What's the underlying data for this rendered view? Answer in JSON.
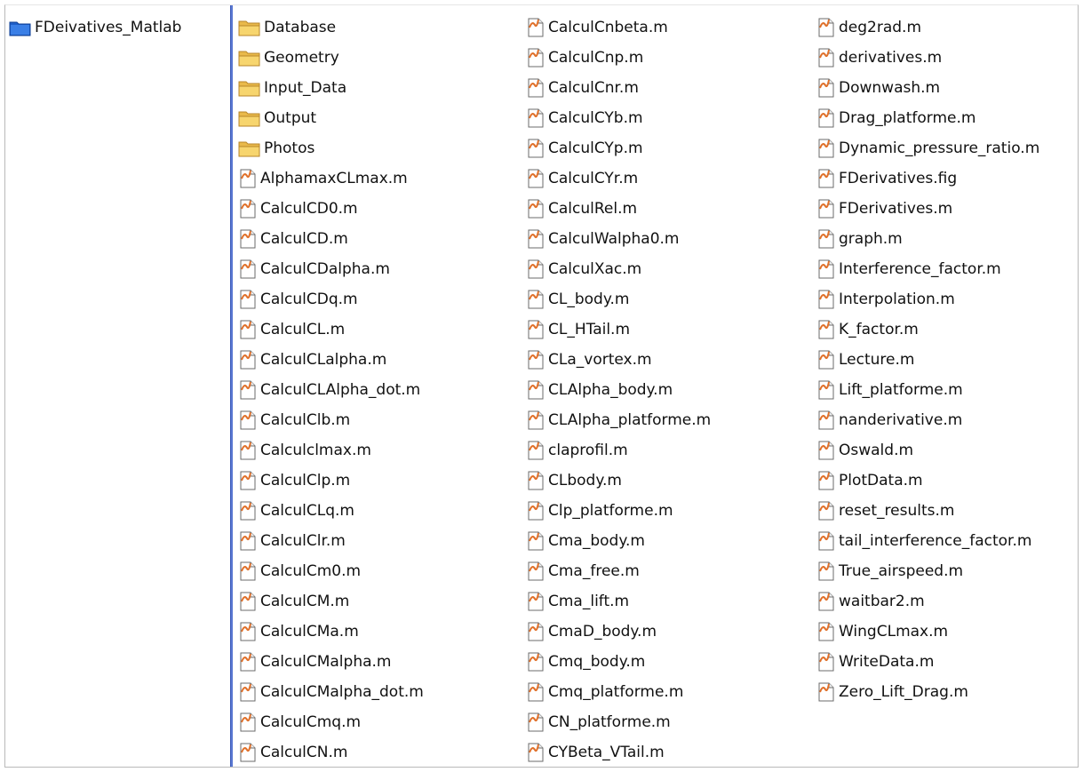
{
  "tree": {
    "root_folder": "FDeivatives_Matlab"
  },
  "columns": [
    [
      {
        "name": "Database",
        "type": "folder"
      },
      {
        "name": "Geometry",
        "type": "folder"
      },
      {
        "name": "Input_Data",
        "type": "folder"
      },
      {
        "name": "Output",
        "type": "folder"
      },
      {
        "name": "Photos",
        "type": "folder"
      },
      {
        "name": "AlphamaxCLmax.m",
        "type": "file"
      },
      {
        "name": "CalculCD0.m",
        "type": "file"
      },
      {
        "name": "CalculCD.m",
        "type": "file"
      },
      {
        "name": "CalculCDalpha.m",
        "type": "file"
      },
      {
        "name": "CalculCDq.m",
        "type": "file"
      },
      {
        "name": "CalculCL.m",
        "type": "file"
      },
      {
        "name": "CalculCLalpha.m",
        "type": "file"
      },
      {
        "name": "CalculCLAlpha_dot.m",
        "type": "file"
      },
      {
        "name": "CalculClb.m",
        "type": "file"
      },
      {
        "name": "Calculclmax.m",
        "type": "file"
      },
      {
        "name": "CalculClp.m",
        "type": "file"
      },
      {
        "name": "CalculCLq.m",
        "type": "file"
      },
      {
        "name": "CalculClr.m",
        "type": "file"
      },
      {
        "name": "CalculCm0.m",
        "type": "file"
      },
      {
        "name": "CalculCM.m",
        "type": "file"
      },
      {
        "name": "CalculCMa.m",
        "type": "file"
      },
      {
        "name": "CalculCMalpha.m",
        "type": "file"
      },
      {
        "name": "CalculCMalpha_dot.m",
        "type": "file"
      },
      {
        "name": "CalculCmq.m",
        "type": "file"
      },
      {
        "name": "CalculCN.m",
        "type": "file"
      }
    ],
    [
      {
        "name": "CalculCnbeta.m",
        "type": "file"
      },
      {
        "name": "CalculCnp.m",
        "type": "file"
      },
      {
        "name": "CalculCnr.m",
        "type": "file"
      },
      {
        "name": "CalculCYb.m",
        "type": "file"
      },
      {
        "name": "CalculCYp.m",
        "type": "file"
      },
      {
        "name": "CalculCYr.m",
        "type": "file"
      },
      {
        "name": "CalculRel.m",
        "type": "file"
      },
      {
        "name": "CalculWalpha0.m",
        "type": "file"
      },
      {
        "name": "CalculXac.m",
        "type": "file"
      },
      {
        "name": "CL_body.m",
        "type": "file"
      },
      {
        "name": "CL_HTail.m",
        "type": "file"
      },
      {
        "name": "CLa_vortex.m",
        "type": "file"
      },
      {
        "name": "CLAlpha_body.m",
        "type": "file"
      },
      {
        "name": "CLAlpha_platforme.m",
        "type": "file"
      },
      {
        "name": "claprofil.m",
        "type": "file"
      },
      {
        "name": "CLbody.m",
        "type": "file"
      },
      {
        "name": "Clp_platforme.m",
        "type": "file"
      },
      {
        "name": "Cma_body.m",
        "type": "file"
      },
      {
        "name": "Cma_free.m",
        "type": "file"
      },
      {
        "name": "Cma_lift.m",
        "type": "file"
      },
      {
        "name": "CmaD_body.m",
        "type": "file"
      },
      {
        "name": "Cmq_body.m",
        "type": "file"
      },
      {
        "name": "Cmq_platforme.m",
        "type": "file"
      },
      {
        "name": "CN_platforme.m",
        "type": "file"
      },
      {
        "name": "CYBeta_VTail.m",
        "type": "file"
      }
    ],
    [
      {
        "name": "deg2rad.m",
        "type": "file"
      },
      {
        "name": "derivatives.m",
        "type": "file"
      },
      {
        "name": "Downwash.m",
        "type": "file"
      },
      {
        "name": "Drag_platforme.m",
        "type": "file"
      },
      {
        "name": "Dynamic_pressure_ratio.m",
        "type": "file"
      },
      {
        "name": "FDerivatives.fig",
        "type": "file"
      },
      {
        "name": "FDerivatives.m",
        "type": "file"
      },
      {
        "name": "graph.m",
        "type": "file"
      },
      {
        "name": "Interference_factor.m",
        "type": "file"
      },
      {
        "name": "Interpolation.m",
        "type": "file"
      },
      {
        "name": "K_factor.m",
        "type": "file"
      },
      {
        "name": "Lecture.m",
        "type": "file"
      },
      {
        "name": "Lift_platforme.m",
        "type": "file"
      },
      {
        "name": "nanderivative.m",
        "type": "file"
      },
      {
        "name": "Oswald.m",
        "type": "file"
      },
      {
        "name": "PlotData.m",
        "type": "file"
      },
      {
        "name": "reset_results.m",
        "type": "file"
      },
      {
        "name": "tail_interference_factor.m",
        "type": "file"
      },
      {
        "name": "True_airspeed.m",
        "type": "file"
      },
      {
        "name": "waitbar2.m",
        "type": "file"
      },
      {
        "name": "WingCLmax.m",
        "type": "file"
      },
      {
        "name": "WriteData.m",
        "type": "file"
      },
      {
        "name": "Zero_Lift_Drag.m",
        "type": "file"
      }
    ]
  ],
  "icons": {
    "folder": "folder-icon",
    "file": "matlab-file-icon",
    "open_folder": "blue-folder-icon"
  },
  "colors": {
    "folder_yellow": "#f2cf5b",
    "folder_border": "#c99a2a",
    "tree_folder_blue": "#2f6fd8",
    "splitter_blue": "#5a78d2",
    "matlab_orange": "#e0702a"
  }
}
